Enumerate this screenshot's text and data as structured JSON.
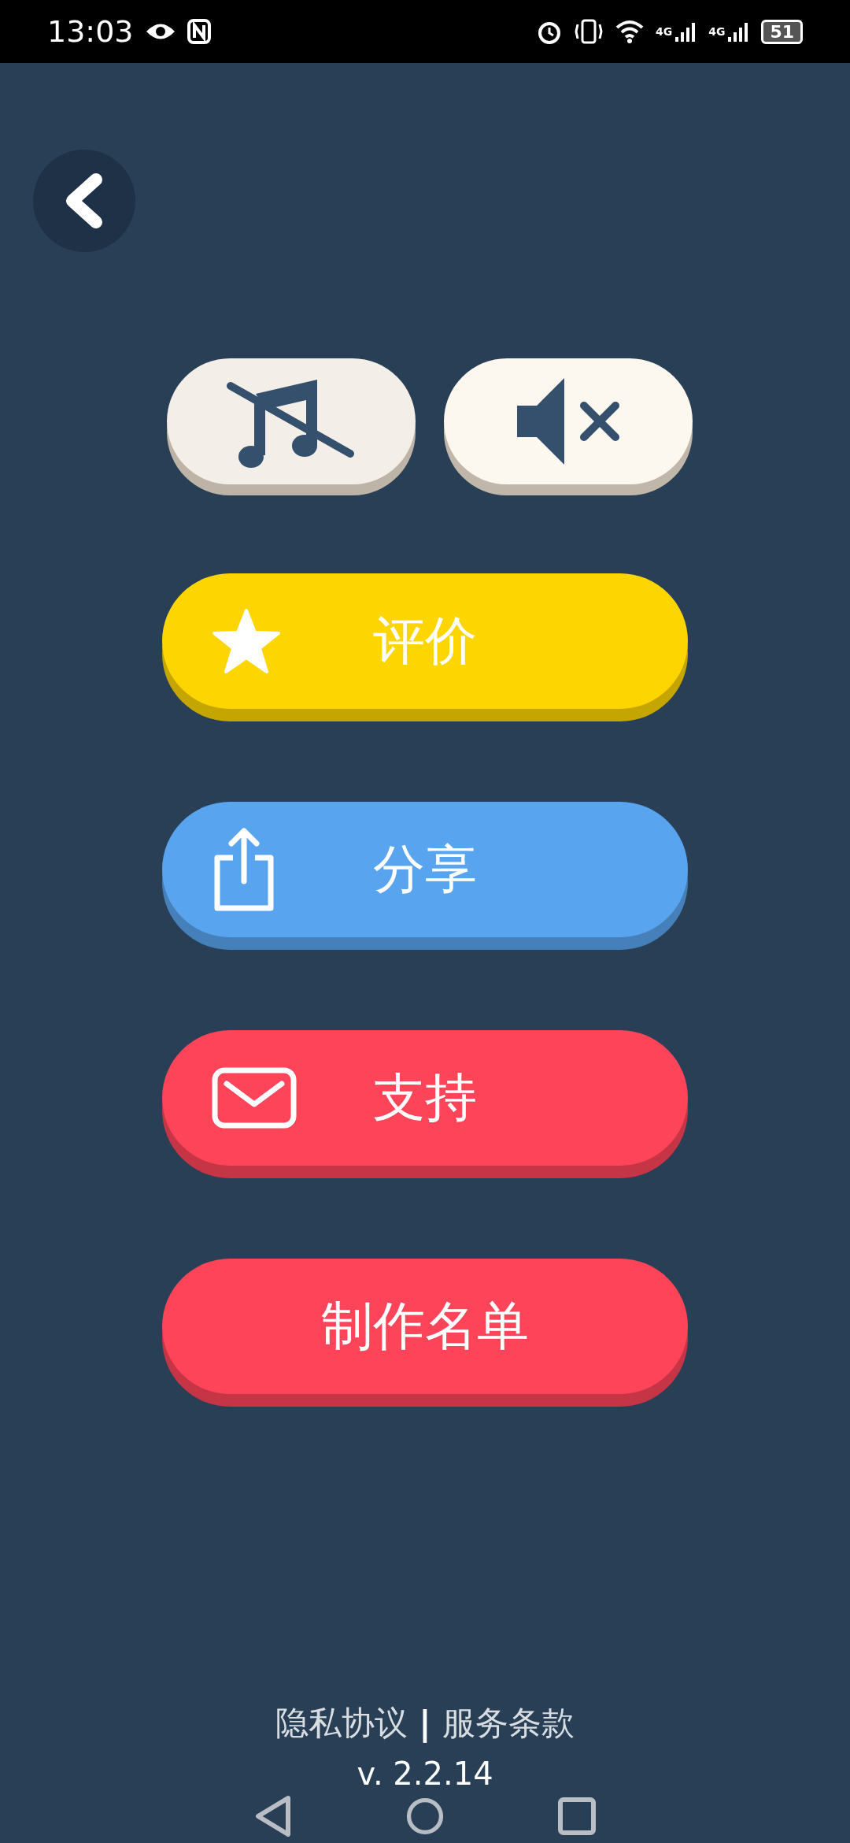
{
  "status_bar": {
    "time": "13:03",
    "battery": "51",
    "network_labels": [
      "4G",
      "4G"
    ]
  },
  "toggles": [
    {
      "kind": "music",
      "muted": true
    },
    {
      "kind": "sound",
      "muted": true
    }
  ],
  "menu_buttons": [
    {
      "label": "评价",
      "kind": "star",
      "color": "#fdd500"
    },
    {
      "label": "分享",
      "kind": "share",
      "color": "#58a4ee"
    },
    {
      "label": "支持",
      "kind": "mail",
      "color": "#fd4458"
    },
    {
      "label": "制作名单",
      "kind": "plain",
      "color": "#fd4458"
    }
  ],
  "footer": {
    "links": [
      "隐私协议",
      "服务条款"
    ],
    "separator": "|",
    "version": "v. 2.2.14"
  }
}
